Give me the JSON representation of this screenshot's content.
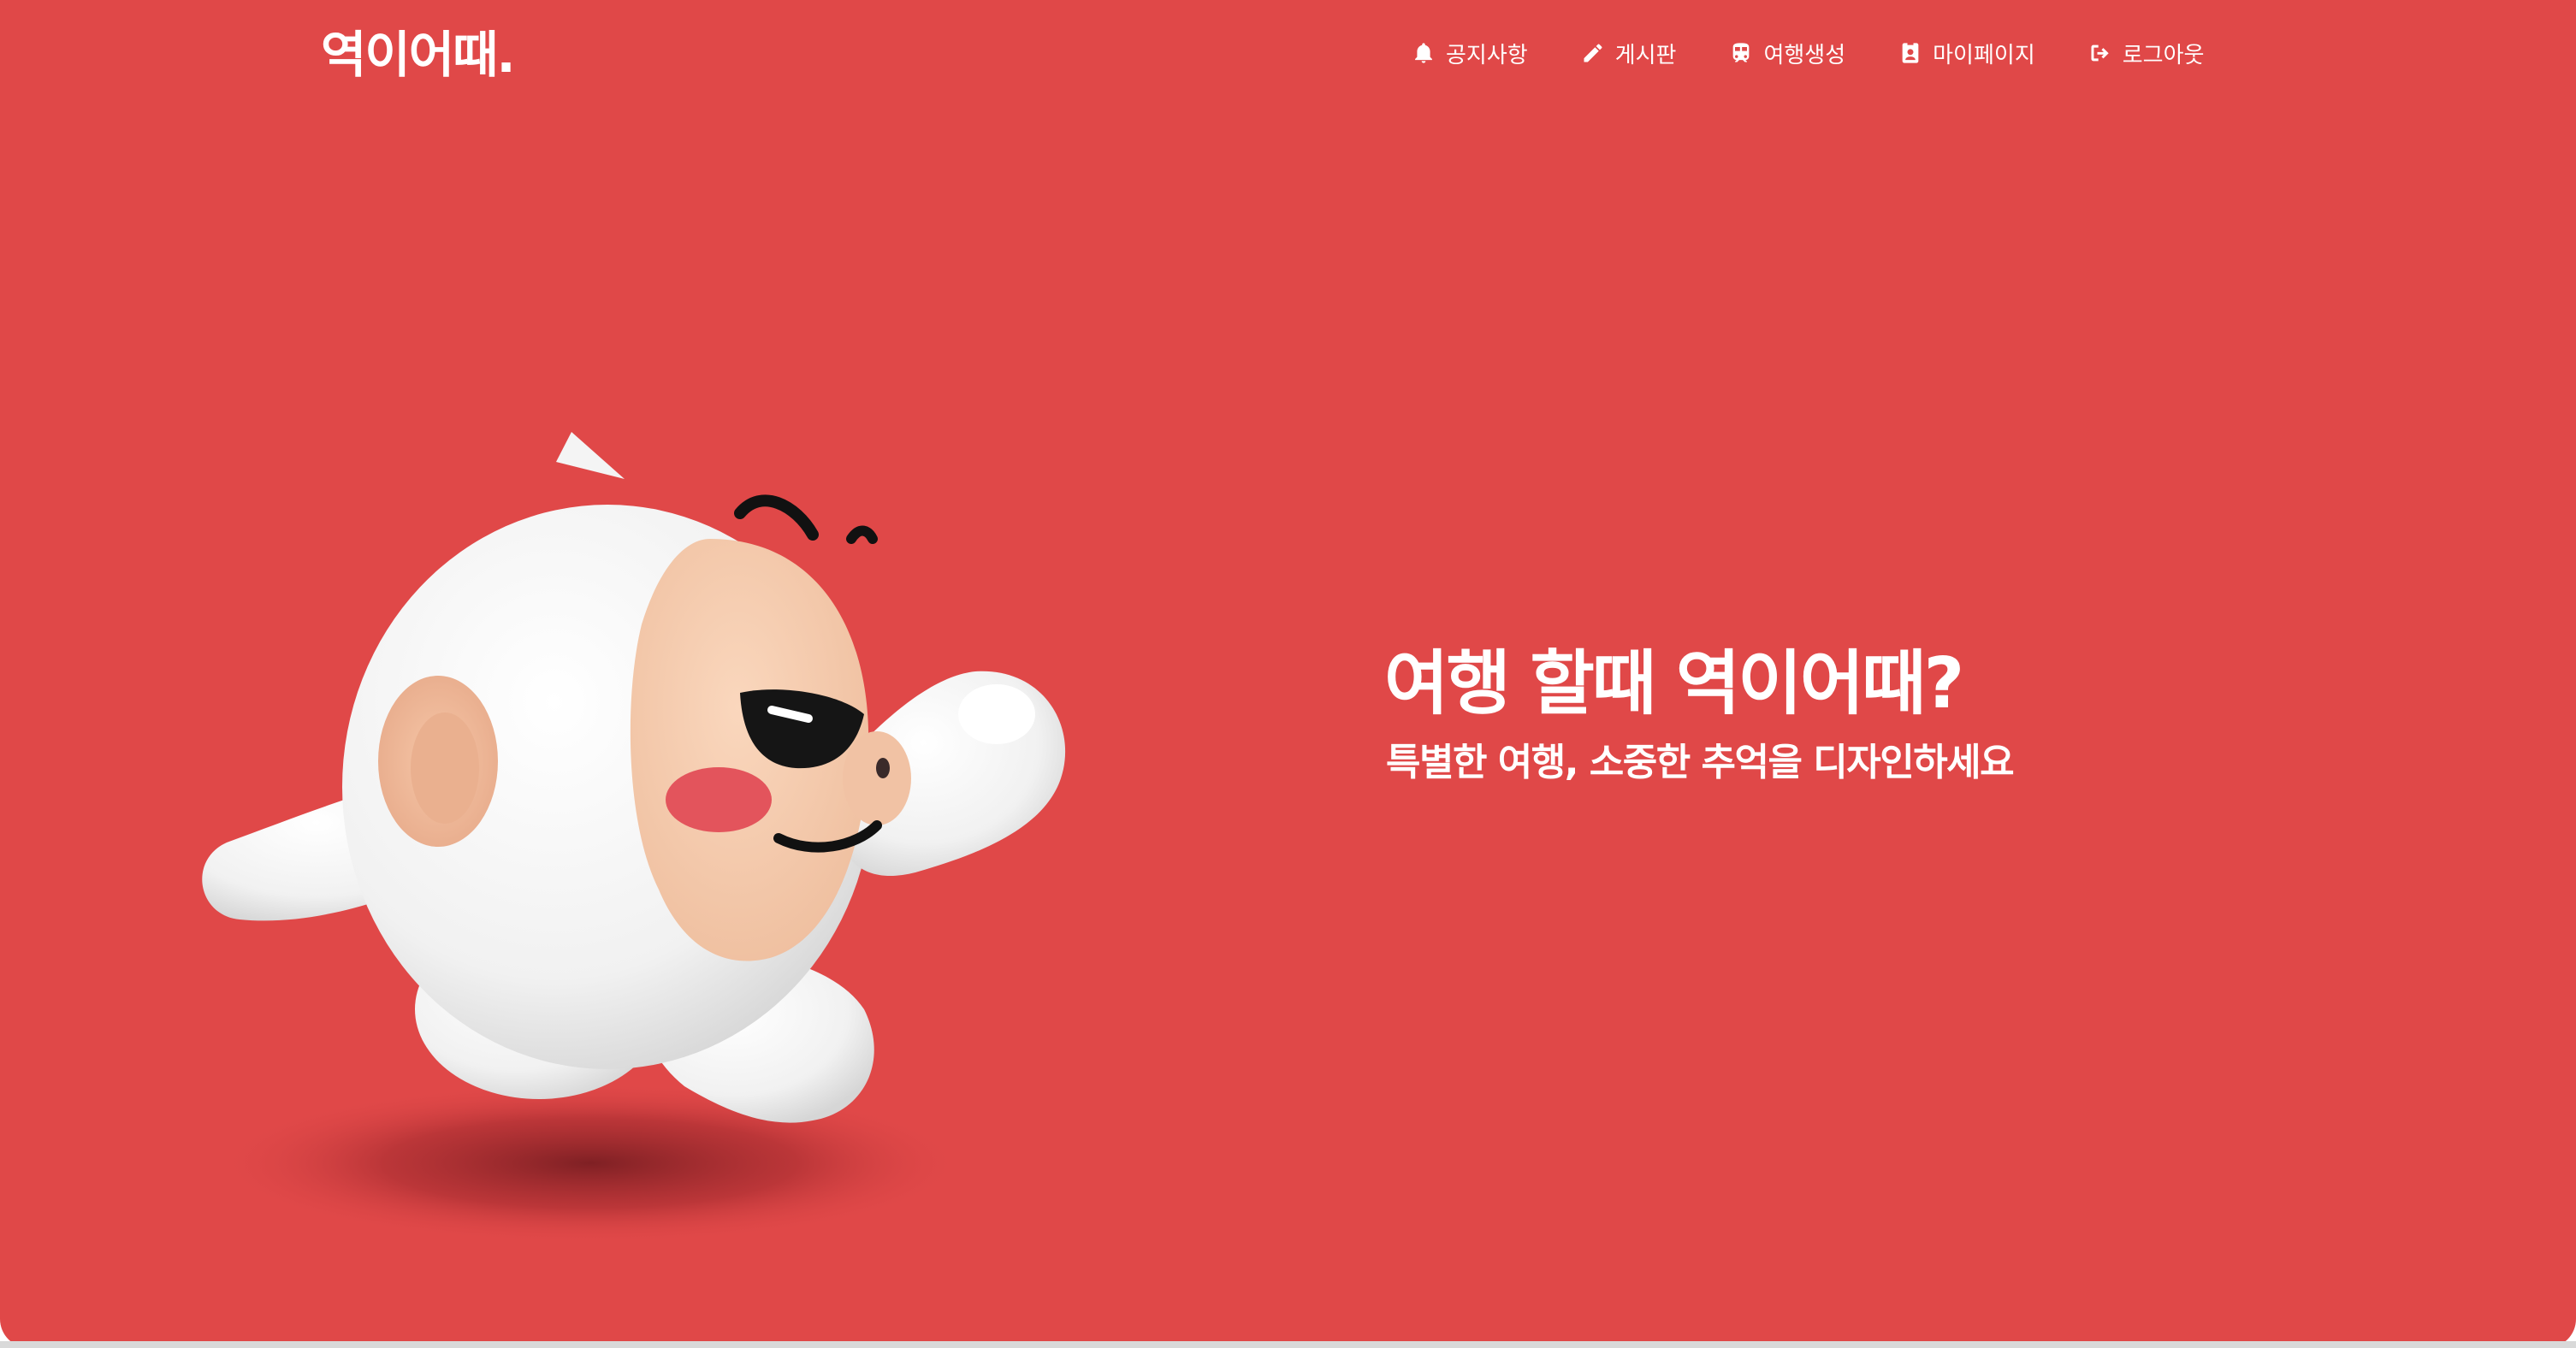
{
  "header": {
    "logo": "역이어때."
  },
  "nav": [
    {
      "icon": "bell-icon",
      "label": "공지사항"
    },
    {
      "icon": "pencil-icon",
      "label": "게시판"
    },
    {
      "icon": "train-icon",
      "label": "여행생성"
    },
    {
      "icon": "user-badge-icon",
      "label": "마이페이지"
    },
    {
      "icon": "logout-icon",
      "label": "로그아웃"
    }
  ],
  "hero": {
    "title": "여행 할때 역이어때?",
    "subtitle": "특별한 여행, 소중한 추억을 디자인하세요"
  },
  "colors": {
    "background": "#e04848",
    "text": "#ffffff"
  }
}
